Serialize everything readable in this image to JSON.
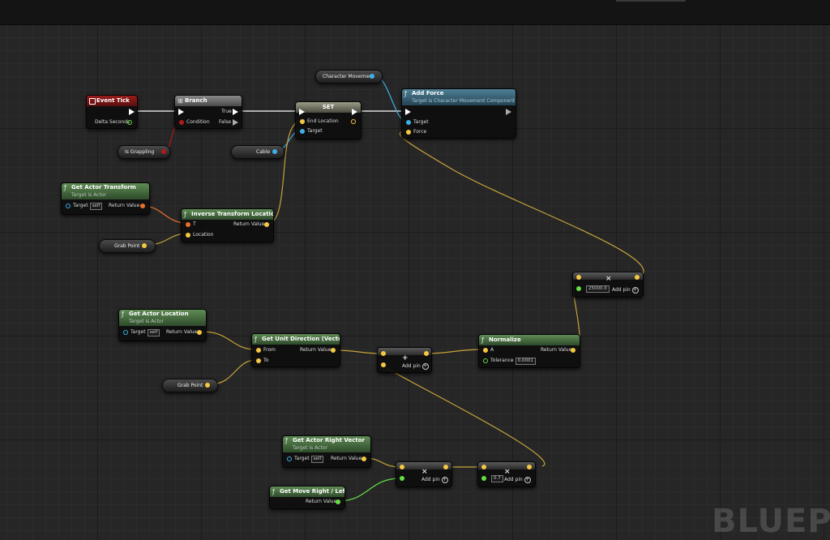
{
  "watermark": "BLUEPR",
  "nodes": {
    "event_tick": {
      "title": "Event Tick",
      "delta": "Delta Seconds"
    },
    "branch": {
      "title": "Branch",
      "condition": "Condition",
      "true_label": "True",
      "false_label": "False"
    },
    "is_grappling": {
      "label": "Is Grappling"
    },
    "set": {
      "title": "SET",
      "end_location": "End Location",
      "target": "Target"
    },
    "cable": {
      "label": "Cable"
    },
    "character_movement": {
      "label": "Character Movement"
    },
    "add_force": {
      "title": "Add Force",
      "subtitle": "Target is Character Movement Component",
      "target": "Target",
      "force": "Force"
    },
    "get_actor_transform": {
      "title": "Get Actor Transform",
      "subtitle": "Target is Actor",
      "target": "Target",
      "self": "self",
      "return_value": "Return Value"
    },
    "inverse_transform": {
      "title": "Inverse Transform Location",
      "t": "T",
      "location": "Location",
      "return_value": "Return Value"
    },
    "grab_point_1": {
      "label": "Grab Point"
    },
    "get_actor_location": {
      "title": "Get Actor Location",
      "subtitle": "Target is Actor",
      "target": "Target",
      "self": "self",
      "return_value": "Return Value"
    },
    "get_unit_direction": {
      "title": "Get Unit Direction (Vector)",
      "from": "From",
      "to": "To",
      "return_value": "Return Value"
    },
    "grab_point_2": {
      "label": "Grab Point"
    },
    "add_vector": {
      "add_pin": "Add pin"
    },
    "normalize": {
      "title": "Normalize",
      "a": "A",
      "tolerance": "Tolerance",
      "tolerance_value": "0.0001",
      "return_value": "Return Value"
    },
    "multiply_force": {
      "value": "25000.0",
      "add_pin": "Add pin"
    },
    "get_actor_right_vector": {
      "title": "Get Actor Right Vector",
      "subtitle": "Target is Actor",
      "target": "Target",
      "self": "self",
      "return_value": "Return Value"
    },
    "get_move_right_left": {
      "title": "Get Move Right / Left",
      "return_value": "Return Value"
    },
    "multiply_right": {
      "add_pin": "Add pin"
    },
    "multiply_scale": {
      "value": "0.7",
      "add_pin": "Add pin"
    }
  },
  "colors": {
    "exec": "#ffffff",
    "vector": "#f5c842",
    "object": "#3fb0e6",
    "bool": "#b01a1a",
    "float": "#66dd44",
    "transform": "#e8702a",
    "event_header": "#9a1a1a",
    "function_header": "#5f8c55",
    "target_header": "#4d7f96"
  }
}
